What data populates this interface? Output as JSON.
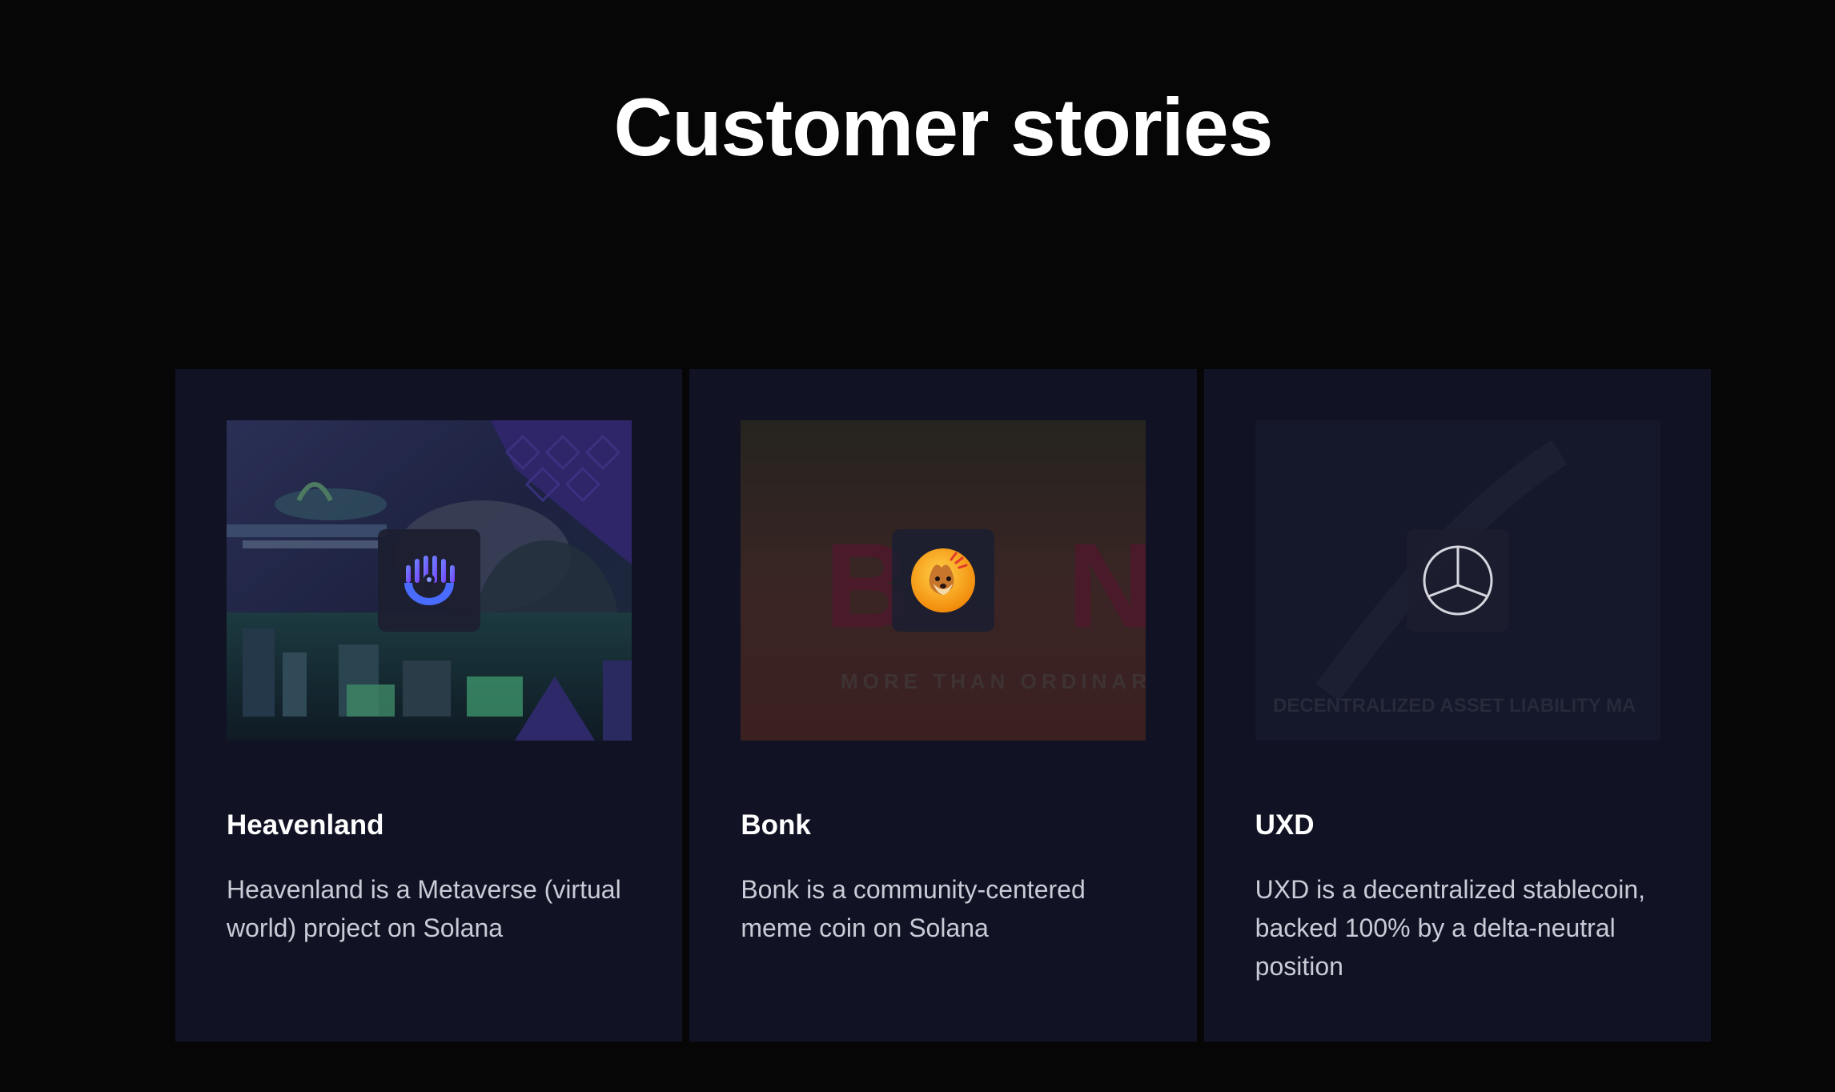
{
  "page": {
    "title": "Customer stories"
  },
  "colors": {
    "background": "#060607",
    "card_background": "#111325",
    "title_text": "#ffffff",
    "description_text": "#c9cbd6"
  },
  "stories": [
    {
      "title": "Heavenland",
      "description": "Heavenland is a Metaverse (virtual world) project on Solana",
      "logo_icon": "heavenland-logo-icon"
    },
    {
      "title": "Bonk",
      "description": "Bonk is a community-centered meme coin on Solana",
      "logo_icon": "bonk-dog-logo-icon",
      "image_text": {
        "headline_left": "B",
        "headline_right": "N",
        "tagline": "MORE THAN ORDINAR"
      }
    },
    {
      "title": "UXD",
      "description": "UXD is a decentralized stablecoin, backed 100% by a delta-neutral position",
      "logo_icon": "uxd-logo-icon",
      "image_text": {
        "tagline": "DECENTRALIZED ASSET LIABILITY MA"
      }
    }
  ]
}
